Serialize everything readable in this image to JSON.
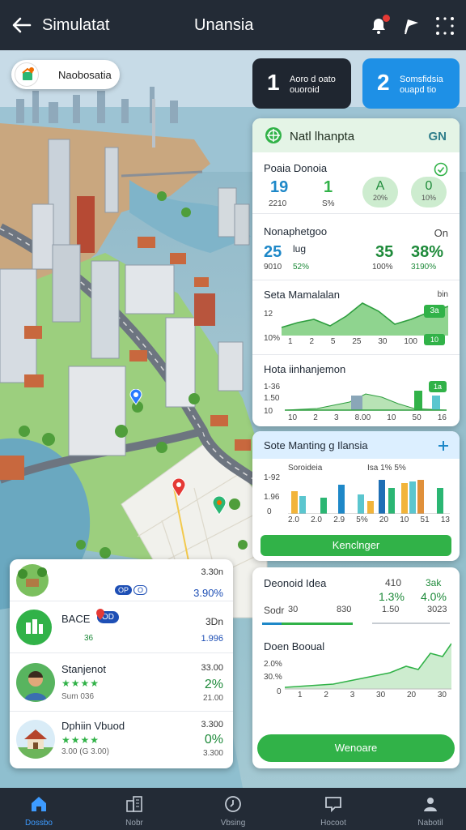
{
  "topbar": {
    "app_title": "Simulatat",
    "center_title": "Unansia",
    "icons": [
      "back-arrow-icon",
      "alert-bell-icon",
      "flag-icon",
      "more-dots-icon"
    ]
  },
  "map": {
    "location_chip": "Naobosatia",
    "pins": [
      "pin-blue",
      "pin-red",
      "pin-green"
    ]
  },
  "tiles": [
    {
      "num": "1",
      "line1": "Aoro d oato",
      "line2": "ouoroid",
      "color": "#1f2630"
    },
    {
      "num": "2",
      "line1": "Somsfidsia",
      "line2": "ouapd tio",
      "color": "#1e90e6"
    }
  ],
  "panel": {
    "header_title": "Natl lhanpta",
    "header_tag": "GN",
    "section1": {
      "title": "Poaia Donoia",
      "v1": "19",
      "v1_sub": "2210",
      "v2": "1",
      "v2_sub": "S%",
      "pill1": "A",
      "pill1_sub": "20%",
      "pill2": "0",
      "pill2_sub": "10%"
    },
    "section2": {
      "title": "Nonaphetgoo",
      "corner": "On",
      "v1": "25",
      "v1_sub": "9010",
      "mid_top": "lug",
      "mid_bottom": "52%",
      "v2": "35",
      "v2_sub": "100%",
      "v3": "38%",
      "v3_sub": "3190%"
    },
    "section3": {
      "title": "Seta Mamalalan",
      "corner": "bin",
      "y_labels": [
        "12",
        "10%"
      ],
      "x_labels": [
        "1",
        "2",
        "5",
        "25",
        "30",
        "100"
      ],
      "badge": "3a",
      "badge2": "10"
    },
    "section4": {
      "title": "Hota iinhanjemon",
      "y_labels": [
        "1-36",
        "1.50",
        "10"
      ],
      "x_labels": [
        "10",
        "2",
        "3",
        "8.00",
        "10",
        "50",
        "16"
      ],
      "badge": "1a"
    }
  },
  "panel2": {
    "title": "Sote Manting g Ilansia",
    "subtitle": "Soroideia",
    "legend": "Isa 1% 5%",
    "y_labels": [
      "1-92",
      "1.96",
      "0"
    ],
    "x_labels": [
      "2.0",
      "2.0",
      "2.9",
      "5%",
      "20",
      "10",
      "51",
      "13"
    ],
    "button": "Kenclnger"
  },
  "panel3": {
    "title": "Deonoid Idea",
    "c1_top": "410",
    "c1_mid": "1.3%",
    "c1_bot": "1.50",
    "c2_top": "3ak",
    "c2_mid": "4.0%",
    "c2_bot": "3023",
    "row_label": "Sodr",
    "row_v1": "30",
    "row_v2": "830",
    "chart_title": "Doen Booual",
    "y_labels": [
      "2.0%",
      "30.%",
      "0"
    ],
    "x_labels": [
      "1",
      "2",
      "3",
      "30",
      "20",
      "30"
    ],
    "button": "Wenoare"
  },
  "list": [
    {
      "name": "",
      "sub": "",
      "r1": "3.30n",
      "r2": "3.90%",
      "r3": "",
      "tags": [
        "OP",
        "O"
      ]
    },
    {
      "name": "BACE",
      "sub": "36",
      "r1": "3Dn",
      "r2": "",
      "r3": "1.996",
      "tag": "OD"
    },
    {
      "name": "Stanjenot",
      "sub": "Sum 036",
      "r1": "33.00",
      "r2": "2%",
      "r3": "21.00"
    },
    {
      "name": "Dphiin Vbuod",
      "sub": "3.00 (G 3.00)",
      "r1": "3.300",
      "r2": "0%",
      "r3": "3.300"
    }
  ],
  "nav": [
    {
      "label": "Dossbo",
      "icon": "home-icon",
      "active": true
    },
    {
      "label": "Nobr",
      "icon": "buildings-icon",
      "active": false
    },
    {
      "label": "Vbsing",
      "icon": "clock-icon",
      "active": false
    },
    {
      "label": "Hocoot",
      "icon": "chat-icon",
      "active": false
    },
    {
      "label": "Nabotil",
      "icon": "profile-icon",
      "active": false
    }
  ],
  "colors": {
    "topbar": "#232b36",
    "green": "#31b248",
    "blue": "#1e90e6",
    "teal": "#2e7d8a"
  }
}
